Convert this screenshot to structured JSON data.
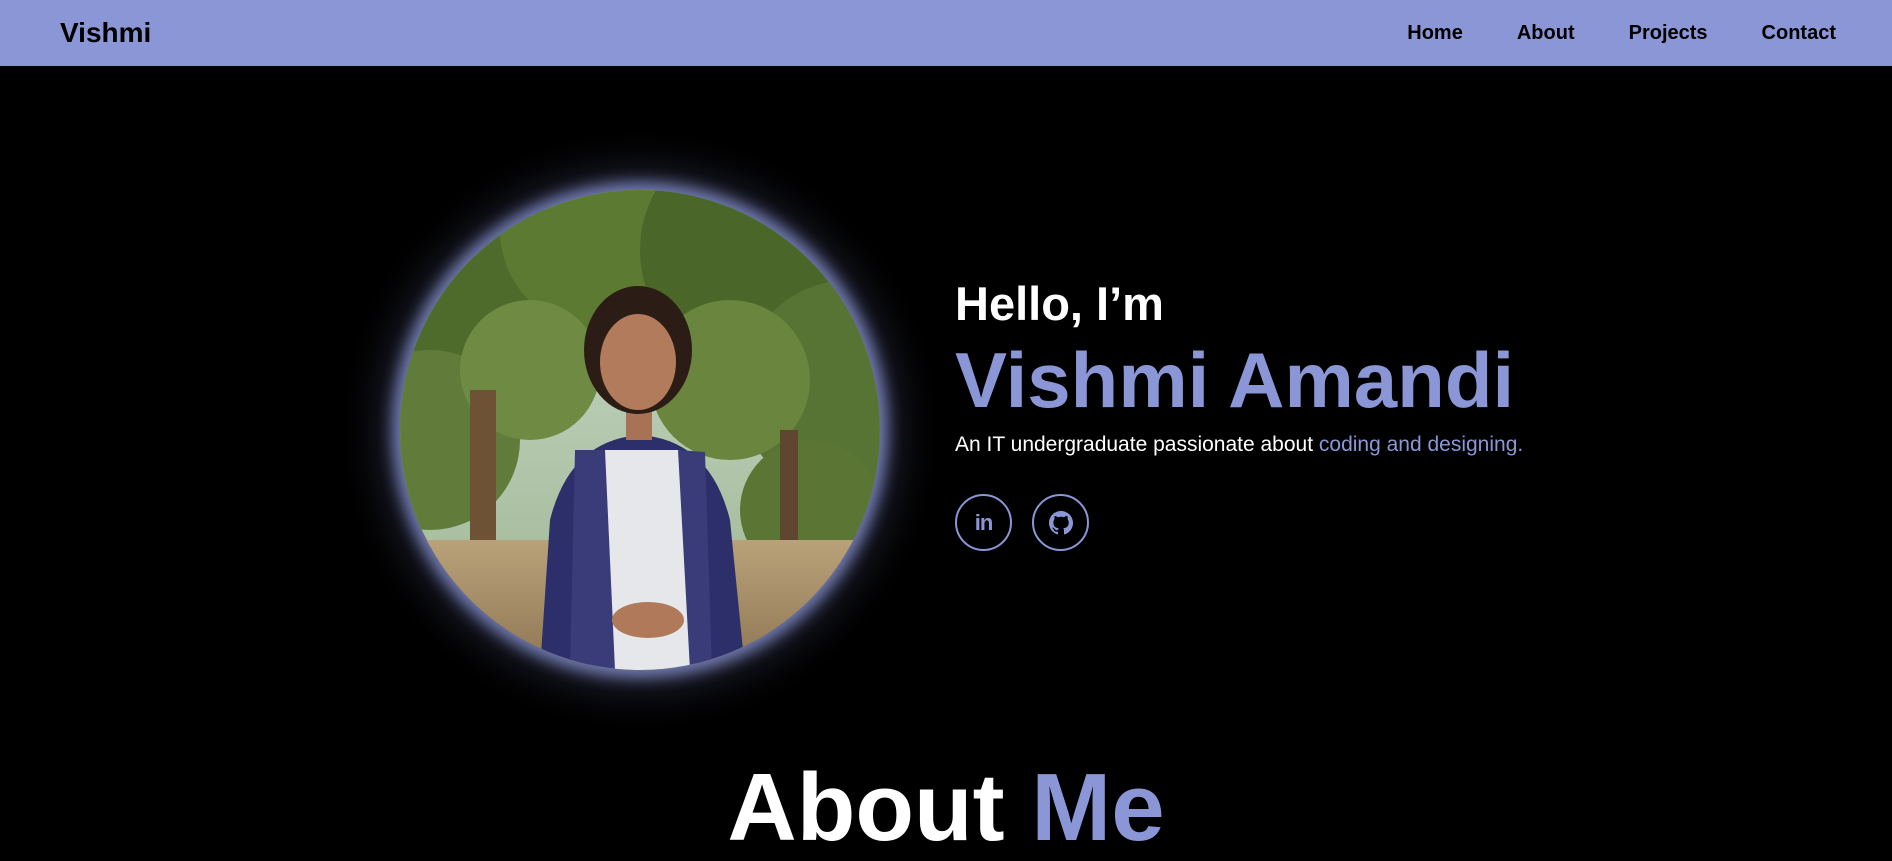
{
  "nav": {
    "brand": "Vishmi",
    "links": [
      "Home",
      "About",
      "Projects",
      "Contact"
    ]
  },
  "hero": {
    "greeting": "Hello, I’m",
    "name": "Vishmi Amandi",
    "tagline_prefix": "An IT undergraduate passionate about ",
    "tagline_accent": "coding and designing.",
    "portrait_alt": "Portrait photo",
    "socials": [
      {
        "label": "in",
        "icon": "linkedin-icon"
      },
      {
        "label": "",
        "icon": "github-icon"
      }
    ]
  },
  "about": {
    "heading_white": "About ",
    "heading_accent": "Me"
  },
  "colors": {
    "accent": "#8b96d6",
    "background": "#000000",
    "navbar": "#8b96d6"
  }
}
